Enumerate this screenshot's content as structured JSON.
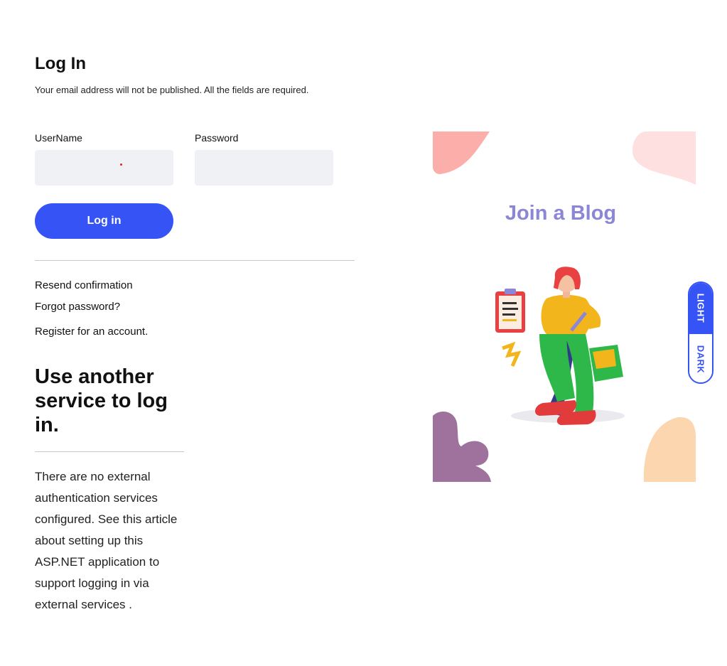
{
  "header": {
    "title": "Log In",
    "subtitle": "Your email address will not be published. All the fields are required."
  },
  "form": {
    "username_label": "UserName",
    "username_value": "",
    "password_label": "Password",
    "password_value": "",
    "login_button": "Log in"
  },
  "links": {
    "resend": "Resend confirmation",
    "forgot": "Forgot password?",
    "register": "Register for an account."
  },
  "external": {
    "heading": "Use another service to log in.",
    "text_before": "There are no external authentication services configured. See this ",
    "link_text": "article about setting up this ASP.NET application to support logging in via external services",
    "text_after": " ."
  },
  "illustration": {
    "title": "Join a Blog"
  },
  "theme_toggle": {
    "light": "LIGHT",
    "dark": "DARK",
    "active": "light"
  },
  "colors": {
    "accent": "#3654f5",
    "input_bg": "#f0f1f5",
    "illustration_title": "#8b86d6"
  }
}
